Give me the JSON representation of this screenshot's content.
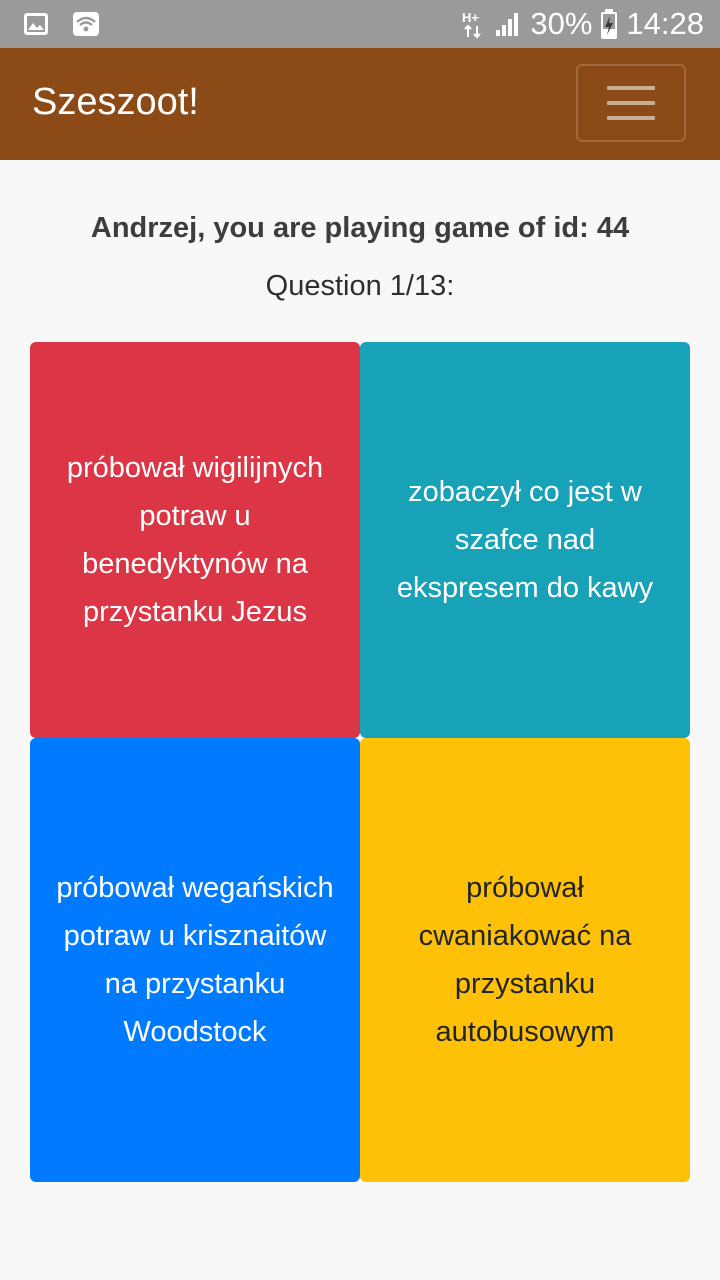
{
  "status_bar": {
    "battery": "30%",
    "time": "14:28",
    "icons": [
      "image-icon",
      "wifi-icon",
      "hplus-icon",
      "signal-icon",
      "battery-charging-icon"
    ]
  },
  "navbar": {
    "brand": "Szeszoot!",
    "color": "#8b4a16",
    "menu_icon": "hamburger-icon"
  },
  "game": {
    "heading": "Andrzej, you are playing game of id: 44",
    "question": "Question 1/13:"
  },
  "answers": [
    {
      "text": "próbował wigilijnych potraw u benedyktynów na przystanku Jezus",
      "color": "#dc3545"
    },
    {
      "text": "zobaczył co jest w szafce nad ekspresem do kawy",
      "color": "#17a2b8"
    },
    {
      "text": "próbował wegańskich potraw u krisznaitów na przystanku Woodstock",
      "color": "#007bff"
    },
    {
      "text": "próbował cwaniakować na przystanku autobusowym",
      "color": "#ffc107"
    }
  ]
}
